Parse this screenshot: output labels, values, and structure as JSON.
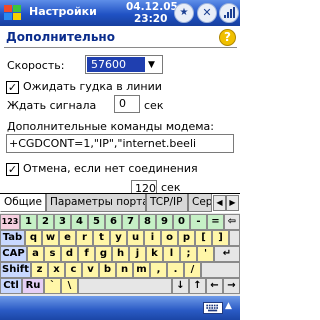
{
  "titlebar": {
    "app_title": "Настройки",
    "date": "04.12.05",
    "time": "23:20",
    "star_icon": "★",
    "close_icon": "✕"
  },
  "page": {
    "title": "Дополнительно",
    "help_icon": "?"
  },
  "form": {
    "speed_label": "Скорость:",
    "speed_value": "57600",
    "dial_tone_label": "Ожидать гудка в линии",
    "dial_tone_checked": true,
    "wait_label": "Ждать сигнала",
    "wait_value": "0",
    "wait_unit": "сек",
    "extra_label": "Дополнительные команды модема:",
    "extra_value": "+CGDCONT=1,\"IP\",\"internet.beeli",
    "cancel_label": "Отмена, если нет соединения",
    "cancel_checked": true,
    "timeout_value": "120",
    "timeout_unit": "сек"
  },
  "tabs": [
    {
      "label": "Общие"
    },
    {
      "label": "Параметры порта"
    },
    {
      "label": "TCP/IP"
    },
    {
      "label": "Сер"
    }
  ],
  "keyboard": {
    "row1": [
      "123",
      "1",
      "2",
      "3",
      "4",
      "5",
      "6",
      "7",
      "8",
      "9",
      "0",
      "-",
      "="
    ],
    "row2": [
      "Tab",
      "q",
      "w",
      "e",
      "r",
      "t",
      "y",
      "u",
      "i",
      "o",
      "p",
      "[",
      "]"
    ],
    "row3": [
      "CAP",
      "a",
      "s",
      "d",
      "f",
      "g",
      "h",
      "j",
      "k",
      "l",
      ";",
      "'"
    ],
    "row4": [
      "Shift",
      "z",
      "x",
      "c",
      "v",
      "b",
      "n",
      "m",
      ",",
      ".",
      "/"
    ],
    "row5": [
      "Ctl",
      "Ru",
      "`",
      "\\",
      "↓",
      "↑",
      "←",
      "→"
    ]
  },
  "colors": {
    "titlebar": "#2052c4",
    "accent_blue": "#0a2c8c",
    "select_highlight": "#1f3fb0"
  }
}
